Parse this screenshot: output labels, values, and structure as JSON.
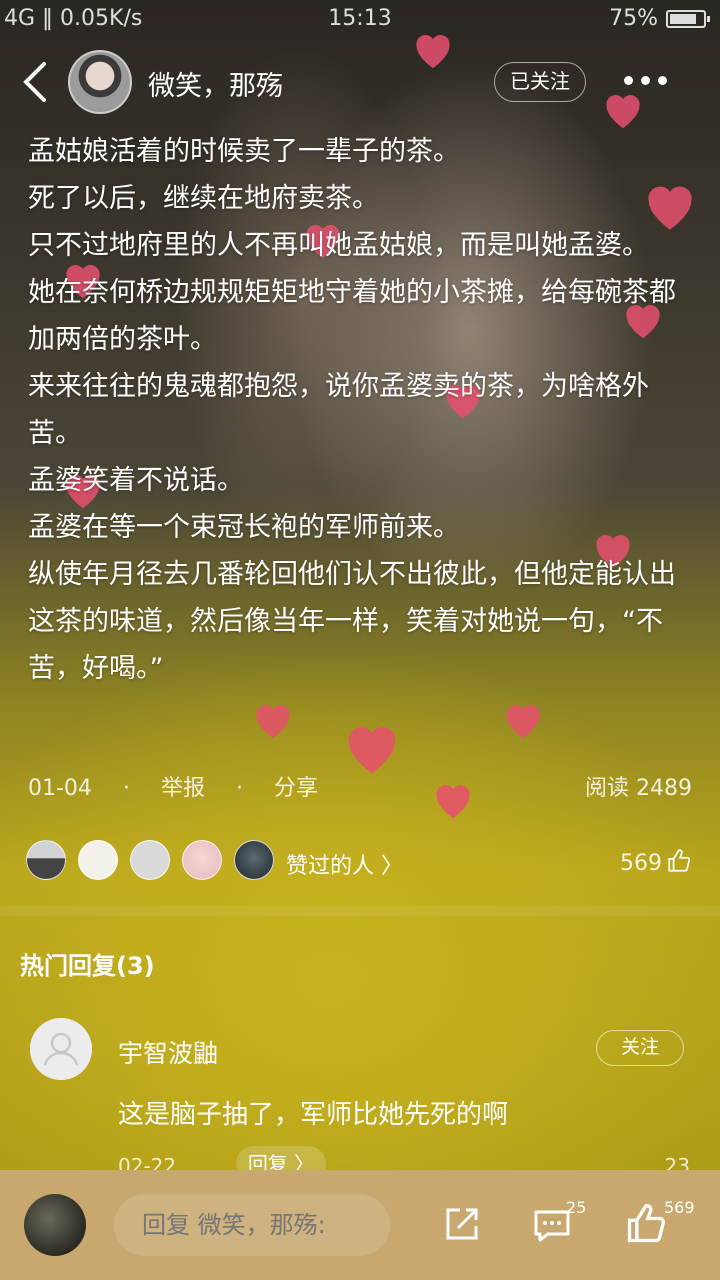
{
  "status_bar": {
    "network": "4G ‖ 0.05K/s",
    "time": "15:13",
    "battery": "75%"
  },
  "header": {
    "author": "微笑，那殇",
    "follow_label": "已关注"
  },
  "story": {
    "paragraphs": [
      "孟姑娘活着的时候卖了一辈子的茶。",
      "死了以后，继续在地府卖茶。",
      "只不过地府里的人不再叫她孟姑娘，而是叫她孟婆。",
      "她在奈何桥边规规矩矩地守着她的小茶摊，给每碗茶都加两倍的茶叶。",
      "来来往往的鬼魂都抱怨，说你孟婆卖的茶，为啥格外苦。",
      "孟婆笑着不说话。",
      "孟婆在等一个束冠长袍的军师前来。",
      "纵使年月径去几番轮回他们认不出彼此，但他定能认出这茶的味道，然后像当年一样，笑着对她说一句，“不苦，好喝。”"
    ]
  },
  "meta": {
    "date": "01-04",
    "report": "举报",
    "share": "分享",
    "reads": "阅读 2489"
  },
  "likers": {
    "label": "赞过的人 〉",
    "count": "569"
  },
  "hot_replies": {
    "title": "热门回复(3)",
    "items": [
      {
        "user": "宇智波鼬",
        "follow_label": "关注",
        "text": "这是脑子抽了，军师比她先死的啊",
        "date": "02-22",
        "reply_label": "回复 〉",
        "likes": "23"
      }
    ]
  },
  "bottom_bar": {
    "input_placeholder": "回复 微笑，那殇:",
    "comments_count": "25",
    "likes_count": "569"
  },
  "colors": {
    "bottom_bar": "#c8a86e",
    "heart": "#e8506e"
  }
}
